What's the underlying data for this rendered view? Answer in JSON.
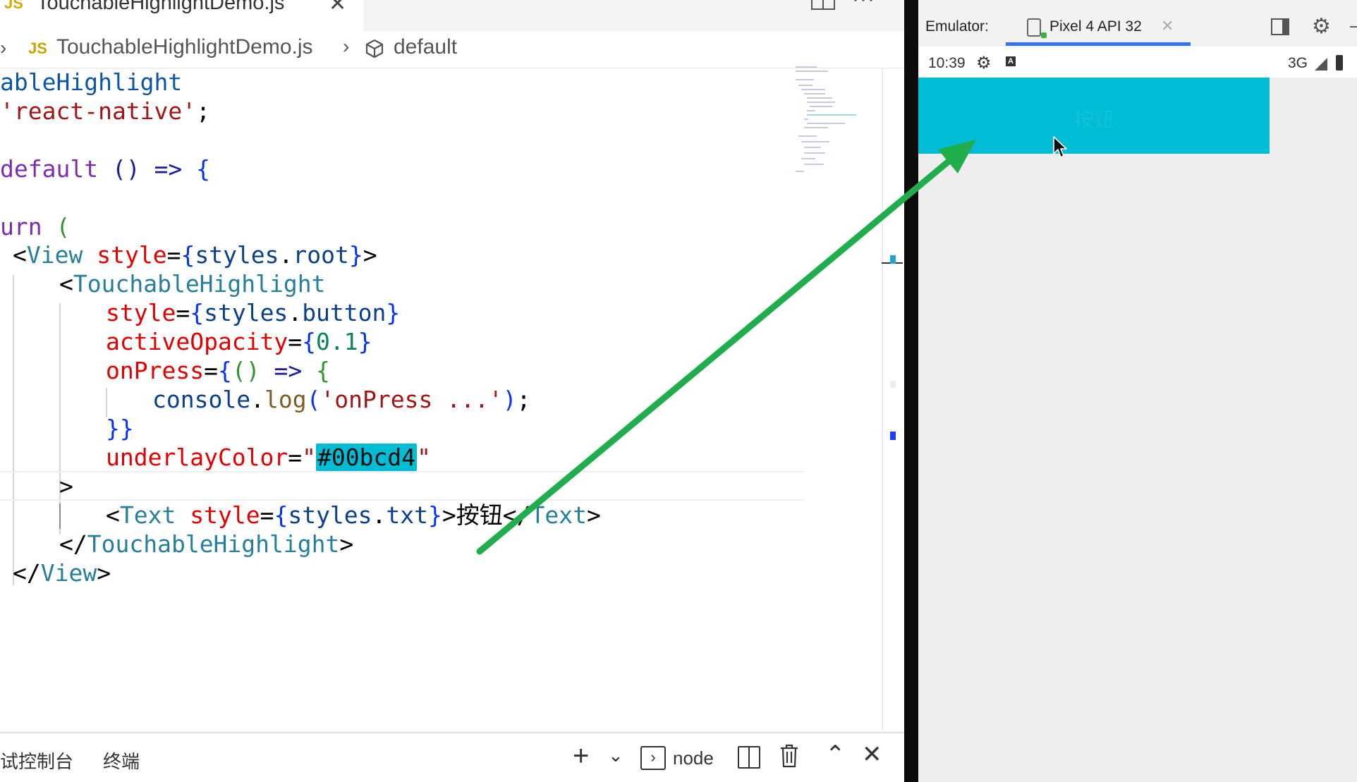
{
  "editor": {
    "tab": {
      "title": "TouchableHighlightDemo.js",
      "icon": "JS",
      "close": "✕"
    },
    "more": "···",
    "breadcrumb": {
      "chevron": "›",
      "lang_icon": "JS",
      "file": "TouchableHighlightDemo.js",
      "symbol": "default"
    },
    "code": {
      "l1": "ableHighlight",
      "l2_str": "'react-native'",
      "l2_end": ";",
      "l4_kw": "default",
      "l4_rest": " () => ",
      "l4_brace": "{",
      "l6_kw": "urn",
      "l6_paren": " (",
      "l7_lt": "<",
      "l7_tag": "View",
      "l7_attr": " style",
      "l7_eq": "=",
      "l7_ob": "{",
      "l7_var": "styles",
      "l7_dot": ".",
      "l7_prop": "root",
      "l7_cb": "}",
      "l7_gt": ">",
      "l8_lt": "<",
      "l8_tag": "TouchableHighlight",
      "l9_attr": "style",
      "l9_eq": "=",
      "l9_ob": "{",
      "l9_var": "styles",
      "l9_dot": ".",
      "l9_prop": "button",
      "l9_cb": "}",
      "l10_attr": "activeOpacity",
      "l10_eq": "=",
      "l10_ob": "{",
      "l10_num": "0.1",
      "l10_cb": "}",
      "l11_attr": "onPress",
      "l11_eq": "=",
      "l11_ob": "{",
      "l11_p": "()",
      "l11_arrow": " => ",
      "l11_brace": "{",
      "l12_obj": "console",
      "l12_dot": ".",
      "l12_fn": "log",
      "l12_op": "(",
      "l12_str": "'onPress ...'",
      "l12_cp": ")",
      "l12_semi": ";",
      "l13": "}}",
      "l14_attr": "underlayColor",
      "l14_eq": "=",
      "l14_q1": "\"",
      "l14_val": "#00bcd4",
      "l14_q2": "\"",
      "l15": ">",
      "l16_lt": "<",
      "l16_tag": "Text",
      "l16_attr": " style",
      "l16_eq": "=",
      "l16_ob": "{",
      "l16_var": "styles",
      "l16_dot": ".",
      "l16_prop": "txt",
      "l16_cb": "}",
      "l16_gt": ">",
      "l16_text": "按钮",
      "l16_close_lt": "</",
      "l16_close_tag": "Text",
      "l16_close_gt": ">",
      "l17_lt": "</",
      "l17_tag": "TouchableHighlight",
      "l17_gt": ">",
      "l18_lt": "</",
      "l18_tag": "View",
      "l18_gt": ">"
    },
    "panel": {
      "tab1": "试控制台",
      "tab2": "终端",
      "plus": "+",
      "chevron": "⌄",
      "term_glyph": "›",
      "shell": "node",
      "up": "⌃",
      "close": "✕"
    }
  },
  "emulator": {
    "label": "Emulator:",
    "device_tab": "Pixel 4 API 32",
    "tab_close": "✕",
    "gear": "⚙",
    "dash": "–",
    "status": {
      "time": "10:39",
      "gear": "⚙",
      "a_icon": "A",
      "network": "3G"
    },
    "button_text": "按钮"
  },
  "colors": {
    "underlay": "#00bcd4",
    "arrow": "#1fae4b",
    "tab_accent": "#3574f0"
  }
}
